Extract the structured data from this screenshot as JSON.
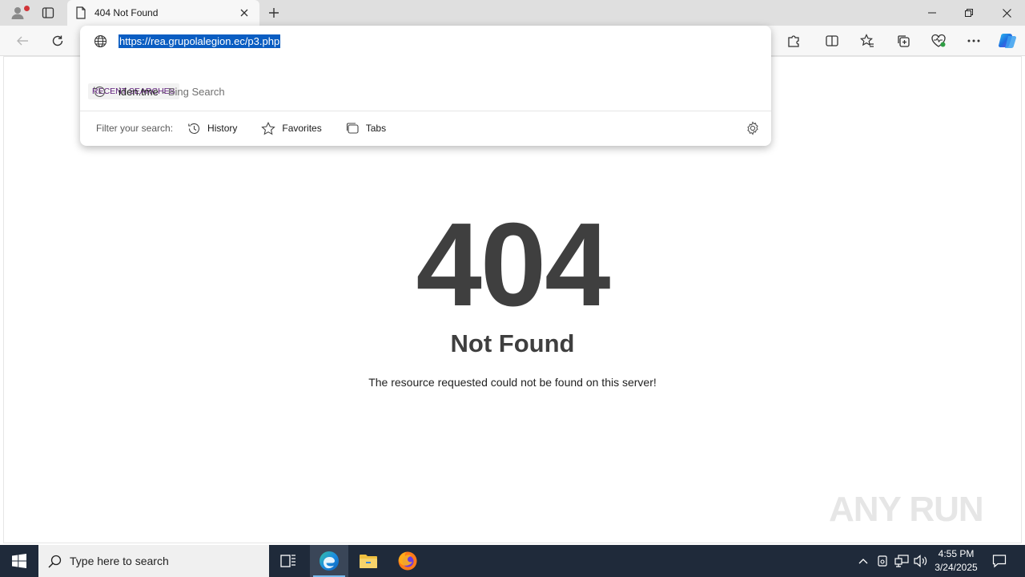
{
  "tab": {
    "title": "404 Not Found"
  },
  "address_bar": {
    "url": "https://rea.grupolalegion.ec/p3.php"
  },
  "omnibox": {
    "recent_label": "RECENT SEARCHES",
    "recent_items": [
      {
        "text": "iden.tme",
        "sub": "- Bing Search"
      }
    ],
    "filter_label": "Filter your search:",
    "filters": [
      {
        "label": "History"
      },
      {
        "label": "Favorites"
      },
      {
        "label": "Tabs"
      }
    ]
  },
  "page": {
    "code": "404",
    "heading": "Not Found",
    "message": "The resource requested could not be found on this server!",
    "watermark": "ANY RUN"
  },
  "taskbar": {
    "search_placeholder": "Type here to search",
    "time": "4:55 PM",
    "date": "3/24/2025"
  },
  "colors": {
    "accent": "#0a5dc2",
    "taskbar": "#1f2a3a",
    "text_dark": "#3f3f3f"
  }
}
